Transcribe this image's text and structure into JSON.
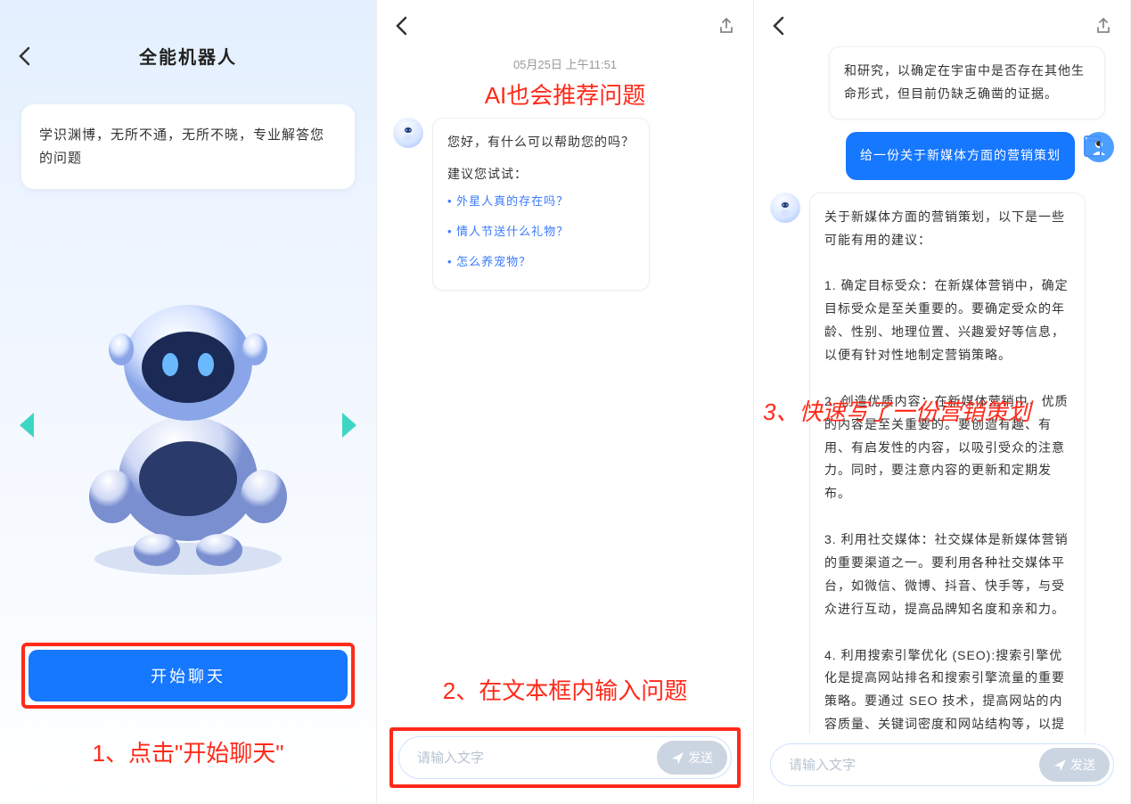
{
  "screen1": {
    "title": "全能机器人",
    "card_text": "学识渊博，无所不通，无所不晓，专业解答您的问题",
    "start_button": "开始聊天",
    "annotation": "1、点击\"开始聊天\""
  },
  "screen2": {
    "timestamp": "05月25日  上午11:51",
    "annotation_top": "AI也会推荐问题",
    "greeting": "您好，有什么可以帮助您的吗？",
    "suggest_title": "建议您试试：",
    "suggestions": [
      "外星人真的存在吗？",
      "情人节送什么礼物？",
      "怎么养宠物？"
    ],
    "annotation_bottom": "2、在文本框内输入问题",
    "input_placeholder": "请输入文字",
    "send_label": "发送"
  },
  "screen3": {
    "bot_msg_top": "和研究，以确定在宇宙中是否存在其他生命形式，但目前仍缺乏确凿的证据。",
    "user_msg": "给一份关于新媒体方面的营销策划",
    "bot_msg_main": "关于新媒体方面的营销策划，以下是一些可能有用的建议：\n\n1. 确定目标受众：在新媒体营销中，确定目标受众是至关重要的。要确定受众的年龄、性别、地理位置、兴趣爱好等信息，以便有针对性地制定营销策略。\n\n2. 创造优质内容：在新媒体营销中，优质的内容是至关重要的。要创造有趣、有用、有启发性的内容，以吸引受众的注意力。同时，要注意内容的更新和定期发布。\n\n3. 利用社交媒体：社交媒体是新媒体营销的重要渠道之一。要利用各种社交媒体平台，如微信、微博、抖音、快手等，与受众进行互动，提高品牌知名度和亲和力。\n\n4. 利用搜索引擎优化 (SEO):搜索引擎优化是提高网站排名和搜索引擎流量的重要策略。要通过 SEO 技术，提高网站的内容质量、关键词密度和网站结构等，以提高网站的排名和流量。",
    "annotation": "3、快速写了一份营销策划",
    "input_placeholder": "请输入文字",
    "send_label": "发送"
  }
}
